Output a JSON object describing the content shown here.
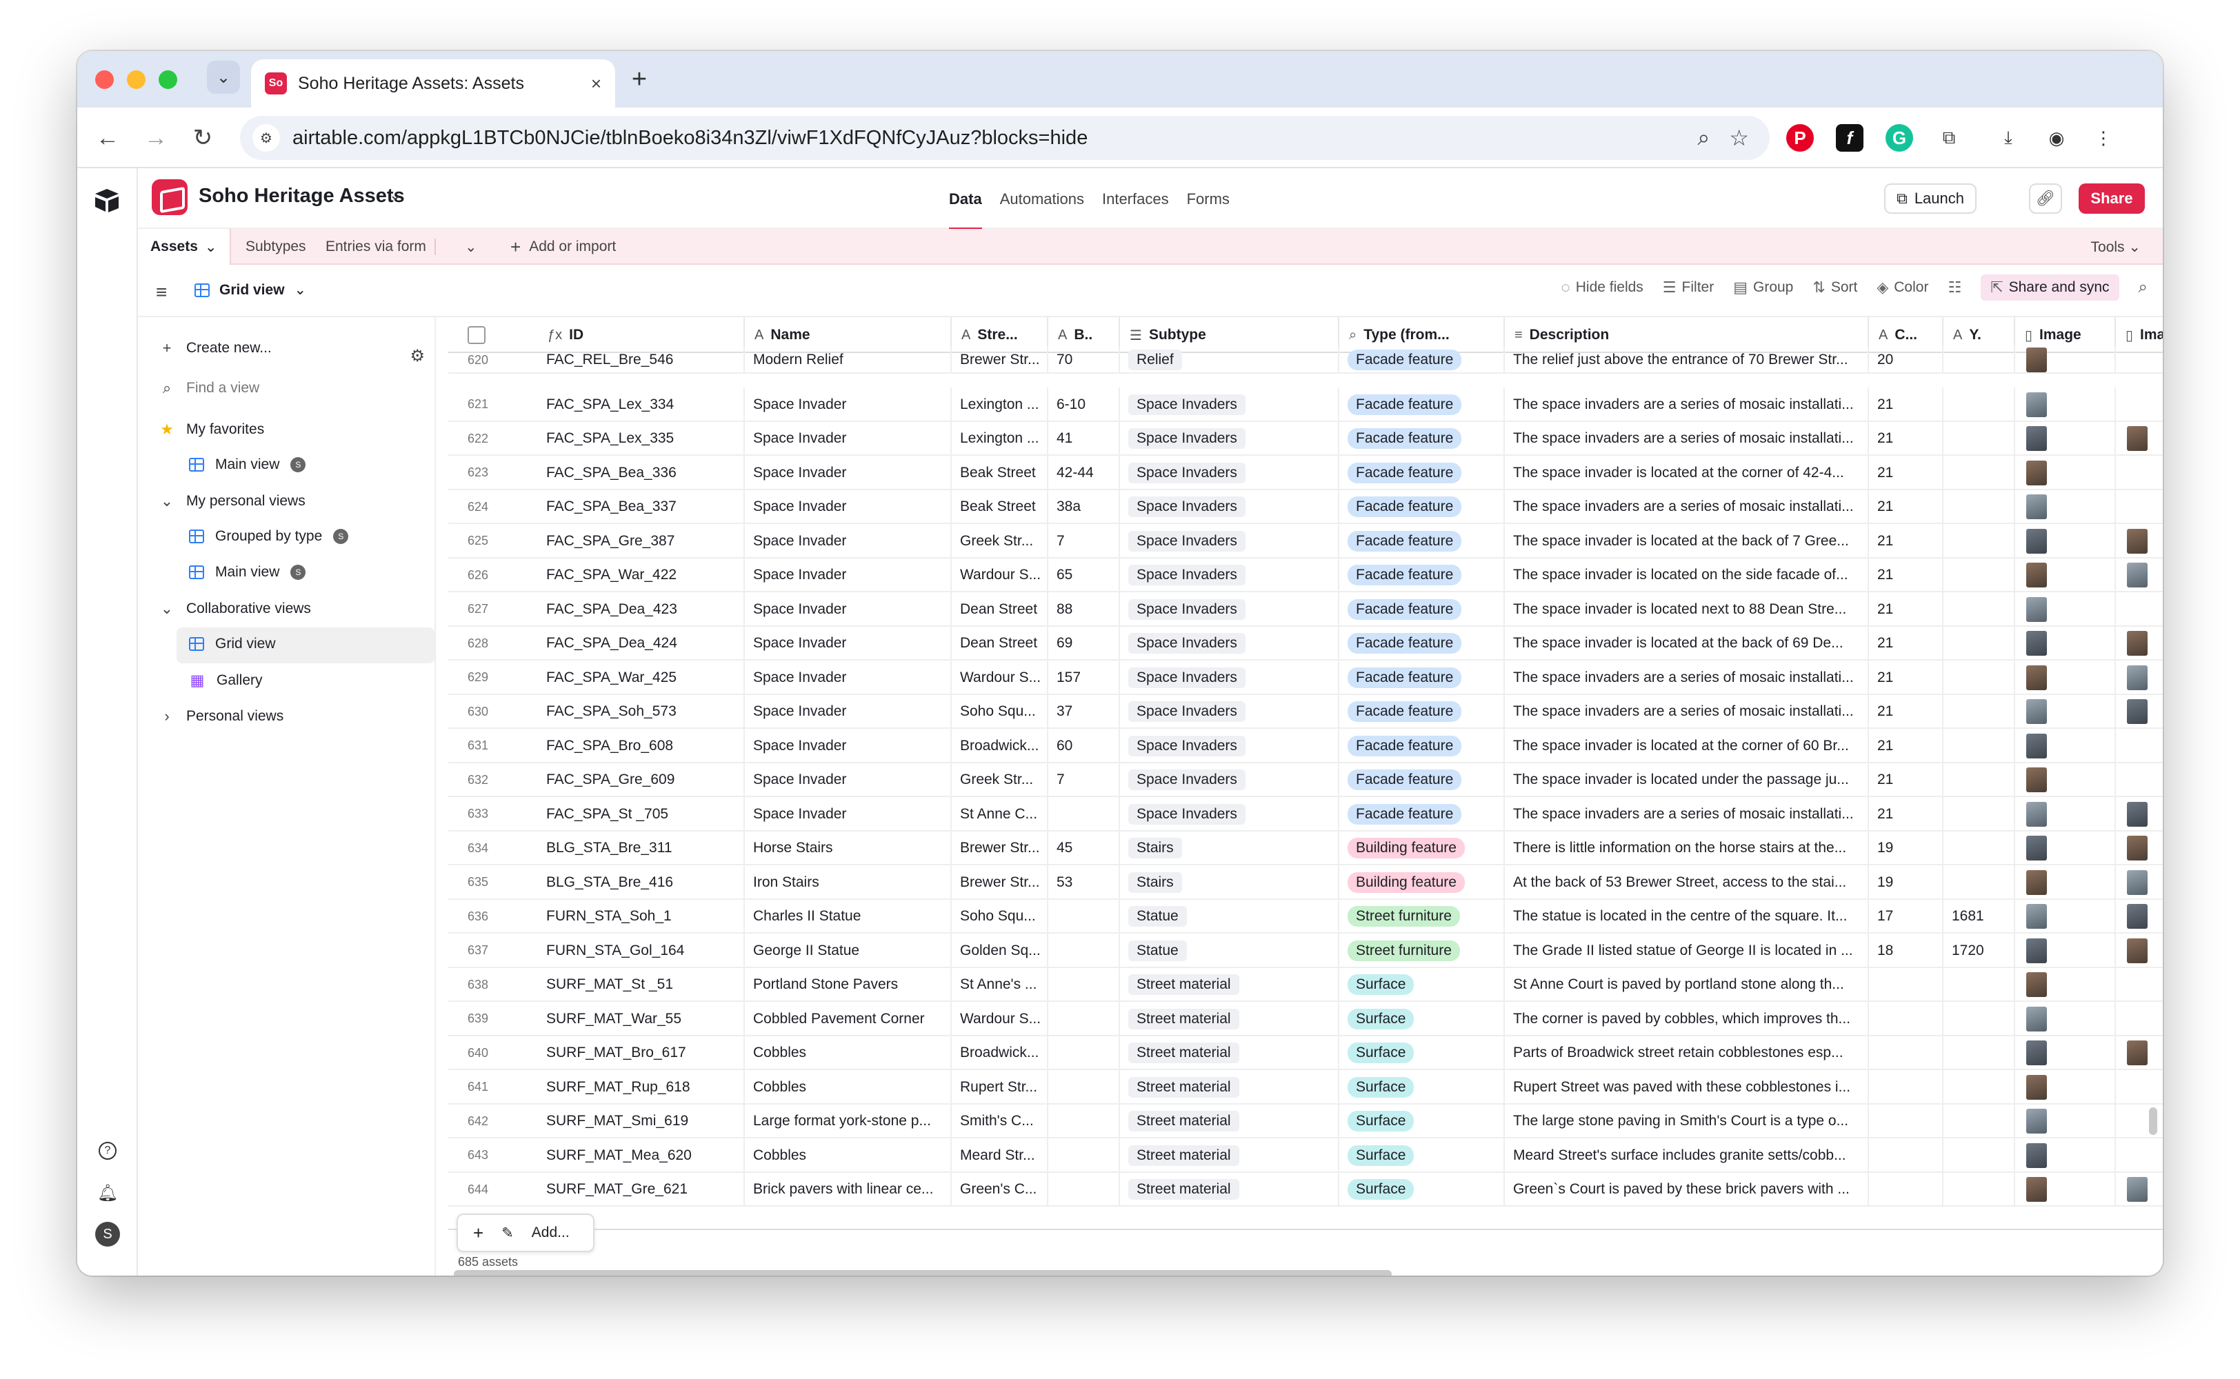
{
  "browser": {
    "tab_title": "Soho Heritage Assets: Assets",
    "tab_favicon": "So",
    "url": "airtable.com/appkgL1BTCb0NJCie/tblnBoeko8i34n3Zl/viwF1XdFQNfCyJAuz?blocks=hide"
  },
  "base": {
    "name": "Soho Heritage Assets",
    "nav": [
      "Data",
      "Automations",
      "Interfaces",
      "Forms"
    ],
    "launch_label": "Launch",
    "share_label": "Share"
  },
  "tablebar": {
    "tables": [
      "Assets",
      "Subtypes",
      "Entries via form"
    ],
    "add_import": "Add or import",
    "tools": "Tools"
  },
  "viewbar": {
    "view_name": "Grid view",
    "hide_fields": "Hide fields",
    "filter": "Filter",
    "group": "Group",
    "sort": "Sort",
    "color": "Color",
    "share_sync": "Share and sync"
  },
  "sidebar": {
    "create_new": "Create new...",
    "find_view": "Find a view",
    "my_favorites": "My favorites",
    "fav_main_view": "Main view",
    "my_personal_views": "My personal views",
    "grouped_by_type": "Grouped by type",
    "personal_main_view": "Main view",
    "collaborative_views": "Collaborative views",
    "grid_view": "Grid view",
    "gallery": "Gallery",
    "personal_views": "Personal views"
  },
  "columns": [
    "ID",
    "Name",
    "Stre...",
    "B..",
    "Subtype",
    "Type (from...",
    "Description",
    "C...",
    "Y.",
    "Image",
    "Ima"
  ],
  "rows": [
    {
      "n": "620",
      "id": "FAC_REL_Bre_546",
      "name": "Modern Relief",
      "street": "Brewer Str...",
      "b": "70",
      "subtype": "Relief",
      "type": "Facade feature",
      "desc": "The relief just above the entrance of 70 Brewer Str...",
      "c": "20",
      "y": "",
      "img2": false
    },
    {
      "n": "621",
      "id": "FAC_SPA_Lex_334",
      "name": "Space Invader",
      "street": "Lexington ...",
      "b": "6-10",
      "subtype": "Space Invaders",
      "type": "Facade feature",
      "desc": "The space invaders are a series of mosaic installati...",
      "c": "21",
      "y": "",
      "img2": false
    },
    {
      "n": "622",
      "id": "FAC_SPA_Lex_335",
      "name": "Space Invader",
      "street": "Lexington ...",
      "b": "41",
      "subtype": "Space Invaders",
      "type": "Facade feature",
      "desc": "The space invaders are a series of mosaic installati...",
      "c": "21",
      "y": "",
      "img2": true
    },
    {
      "n": "623",
      "id": "FAC_SPA_Bea_336",
      "name": "Space Invader",
      "street": "Beak Street",
      "b": "42-44",
      "subtype": "Space Invaders",
      "type": "Facade feature",
      "desc": "The space invader is located at the corner of 42-4...",
      "c": "21",
      "y": "",
      "img2": false
    },
    {
      "n": "624",
      "id": "FAC_SPA_Bea_337",
      "name": "Space Invader",
      "street": "Beak Street",
      "b": "38a",
      "subtype": "Space Invaders",
      "type": "Facade feature",
      "desc": "The space invaders are a series of mosaic installati...",
      "c": "21",
      "y": "",
      "img2": false
    },
    {
      "n": "625",
      "id": "FAC_SPA_Gre_387",
      "name": "Space Invader",
      "street": "Greek Str...",
      "b": "7",
      "subtype": "Space Invaders",
      "type": "Facade feature",
      "desc": "The space invader is located at the back of 7 Gree...",
      "c": "21",
      "y": "",
      "img2": true
    },
    {
      "n": "626",
      "id": "FAC_SPA_War_422",
      "name": "Space Invader",
      "street": "Wardour S...",
      "b": "65",
      "subtype": "Space Invaders",
      "type": "Facade feature",
      "desc": "The space invader is located on the side facade of...",
      "c": "21",
      "y": "",
      "img2": true
    },
    {
      "n": "627",
      "id": "FAC_SPA_Dea_423",
      "name": "Space Invader",
      "street": "Dean Street",
      "b": "88",
      "subtype": "Space Invaders",
      "type": "Facade feature",
      "desc": "The space invader is located next to 88 Dean Stre...",
      "c": "21",
      "y": "",
      "img2": false
    },
    {
      "n": "628",
      "id": "FAC_SPA_Dea_424",
      "name": "Space Invader",
      "street": "Dean Street",
      "b": "69",
      "subtype": "Space Invaders",
      "type": "Facade feature",
      "desc": "The space invader is located at the back of 69 De...",
      "c": "21",
      "y": "",
      "img2": true
    },
    {
      "n": "629",
      "id": "FAC_SPA_War_425",
      "name": "Space Invader",
      "street": "Wardour S...",
      "b": "157",
      "subtype": "Space Invaders",
      "type": "Facade feature",
      "desc": "The space invaders are a series of mosaic installati...",
      "c": "21",
      "y": "",
      "img2": true
    },
    {
      "n": "630",
      "id": "FAC_SPA_Soh_573",
      "name": "Space Invader",
      "street": "Soho Squ...",
      "b": "37",
      "subtype": "Space Invaders",
      "type": "Facade feature",
      "desc": "The space invaders are a series of mosaic installati...",
      "c": "21",
      "y": "",
      "img2": true
    },
    {
      "n": "631",
      "id": "FAC_SPA_Bro_608",
      "name": "Space Invader",
      "street": "Broadwick...",
      "b": "60",
      "subtype": "Space Invaders",
      "type": "Facade feature",
      "desc": "The space invader is located at the corner of 60 Br...",
      "c": "21",
      "y": "",
      "img2": false
    },
    {
      "n": "632",
      "id": "FAC_SPA_Gre_609",
      "name": "Space Invader",
      "street": "Greek Str...",
      "b": "7",
      "subtype": "Space Invaders",
      "type": "Facade feature",
      "desc": "The space invader is located under the passage ju...",
      "c": "21",
      "y": "",
      "img2": false
    },
    {
      "n": "633",
      "id": "FAC_SPA_St _705",
      "name": "Space Invader",
      "street": "St Anne C...",
      "b": "",
      "subtype": "Space Invaders",
      "type": "Facade feature",
      "desc": "The space invaders are a series of mosaic installati...",
      "c": "21",
      "y": "",
      "img2": true
    },
    {
      "n": "634",
      "id": "BLG_STA_Bre_311",
      "name": "Horse Stairs",
      "street": "Brewer Str...",
      "b": "45",
      "subtype": "Stairs",
      "type": "Building feature",
      "desc": "There is little information on the horse stairs at the...",
      "c": "19",
      "y": "",
      "img2": true
    },
    {
      "n": "635",
      "id": "BLG_STA_Bre_416",
      "name": "Iron Stairs",
      "street": "Brewer Str...",
      "b": "53",
      "subtype": "Stairs",
      "type": "Building feature",
      "desc": "At the back of 53 Brewer Street, access to the stai...",
      "c": "19",
      "y": "",
      "img2": true
    },
    {
      "n": "636",
      "id": "FURN_STA_Soh_1",
      "name": "Charles II Statue",
      "street": "Soho Squ...",
      "b": "",
      "subtype": "Statue",
      "type": "Street furniture",
      "desc": "The statue is located in the centre of the square. It...",
      "c": "17",
      "y": "1681",
      "img2": true
    },
    {
      "n": "637",
      "id": "FURN_STA_Gol_164",
      "name": "George II Statue",
      "street": "Golden Sq...",
      "b": "",
      "subtype": "Statue",
      "type": "Street furniture",
      "desc": "The Grade II listed statue of George II is located in ...",
      "c": "18",
      "y": "1720",
      "img2": true
    },
    {
      "n": "638",
      "id": "SURF_MAT_St _51",
      "name": "Portland Stone Pavers",
      "street": "St Anne's ...",
      "b": "",
      "subtype": "Street material",
      "type": "Surface",
      "desc": "St Anne Court is paved by portland stone along th...",
      "c": "",
      "y": "",
      "img2": false
    },
    {
      "n": "639",
      "id": "SURF_MAT_War_55",
      "name": "Cobbled Pavement Corner",
      "street": "Wardour S...",
      "b": "",
      "subtype": "Street material",
      "type": "Surface",
      "desc": "The corner is paved by cobbles, which improves th...",
      "c": "",
      "y": "",
      "img2": false
    },
    {
      "n": "640",
      "id": "SURF_MAT_Bro_617",
      "name": "Cobbles",
      "street": "Broadwick...",
      "b": "",
      "subtype": "Street material",
      "type": "Surface",
      "desc": "Parts of Broadwick street retain cobblestones esp...",
      "c": "",
      "y": "",
      "img2": true
    },
    {
      "n": "641",
      "id": "SURF_MAT_Rup_618",
      "name": "Cobbles",
      "street": "Rupert Str...",
      "b": "",
      "subtype": "Street material",
      "type": "Surface",
      "desc": "Rupert Street was paved with these cobblestones i...",
      "c": "",
      "y": "",
      "img2": false
    },
    {
      "n": "642",
      "id": "SURF_MAT_Smi_619",
      "name": "Large format york-stone p...",
      "street": "Smith's C...",
      "b": "",
      "subtype": "Street material",
      "type": "Surface",
      "desc": "The large stone paving in Smith's Court is a type o...",
      "c": "",
      "y": "",
      "img2": false
    },
    {
      "n": "643",
      "id": "SURF_MAT_Mea_620",
      "name": "Cobbles",
      "street": "Meard Str...",
      "b": "",
      "subtype": "Street material",
      "type": "Surface",
      "desc": "Meard Street's surface includes granite setts/cobb...",
      "c": "",
      "y": "",
      "img2": false
    },
    {
      "n": "644",
      "id": "SURF_MAT_Gre_621",
      "name": "Brick pavers with linear ce...",
      "street": "Green's C...",
      "b": "",
      "subtype": "Street material",
      "type": "Surface",
      "desc": "Green`s Court is paved by these brick pavers with ...",
      "c": "",
      "y": "",
      "img2": true
    }
  ],
  "footer": {
    "record_count": "685 assets",
    "add_label": "Add..."
  },
  "colors": {
    "brand": "#e0244a",
    "facade_feature": "#cfe3fb",
    "building_feature": "#ffd0dd",
    "street_furniture": "#c7f0cc",
    "surface": "#c4eff0"
  }
}
